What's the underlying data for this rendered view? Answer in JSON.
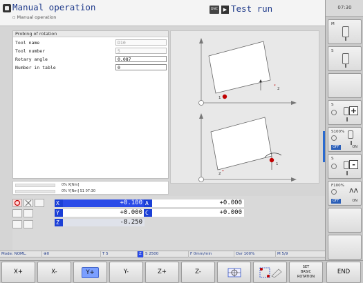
{
  "header": {
    "mode_title": "Manual operation",
    "mode_subtitle": "Manual operation",
    "dnc_label": "DNC",
    "run_title": "Test run"
  },
  "clock": "07:30",
  "form": {
    "title": "Probing of rotation",
    "fields": [
      {
        "label": "Tool name",
        "value": "D10"
      },
      {
        "label": "Tool number",
        "value": "5"
      },
      {
        "label": "Rotary angle",
        "value": "0.087"
      },
      {
        "label": "Number in table",
        "value": "0"
      }
    ]
  },
  "graphic": {
    "point1_label": "1",
    "point2_label": "2"
  },
  "small_status": {
    "line1": "0% X[Nm]",
    "line2": "0% Y[Nm] S1  07:30"
  },
  "positions": [
    {
      "axis": "X",
      "value": "+0.100"
    },
    {
      "axis": "Y",
      "value": "+0.000"
    },
    {
      "axis": "Z",
      "value": "-8.250"
    },
    {
      "axis": "A",
      "value": "+0.000"
    },
    {
      "axis": "C",
      "value": "+0.000"
    }
  ],
  "status_bar": {
    "mode": "Mode: NOML.",
    "spindle": "0",
    "tool": "T 5",
    "z": "Z",
    "speed": "S 2500",
    "feed": "F 0mm/min",
    "override": "Ovr 100%",
    "mfunc": "M 5/9"
  },
  "right_softkeys": {
    "m_label": "M",
    "s_label": "S",
    "s100_label": "S100%",
    "f100_label": "F100%",
    "off_label": "OFF",
    "on_label": "ON",
    "plus": "+",
    "minus": "-"
  },
  "softkeys": [
    {
      "label": "X+"
    },
    {
      "label": "X-"
    },
    {
      "label": "Y+"
    },
    {
      "label": "Y-"
    },
    {
      "label": "Z+"
    },
    {
      "label": "Z-"
    },
    {
      "label": ""
    },
    {
      "label": ""
    },
    {
      "label": "SET BASIC ROTATION",
      "lines": [
        "SET",
        "BASIC",
        "ROTATION"
      ]
    },
    {
      "label": "END"
    }
  ],
  "colors": {
    "axis_blue": "#2a4be8",
    "title_blue": "#1f3a8a",
    "probe_red": "#c00000"
  }
}
